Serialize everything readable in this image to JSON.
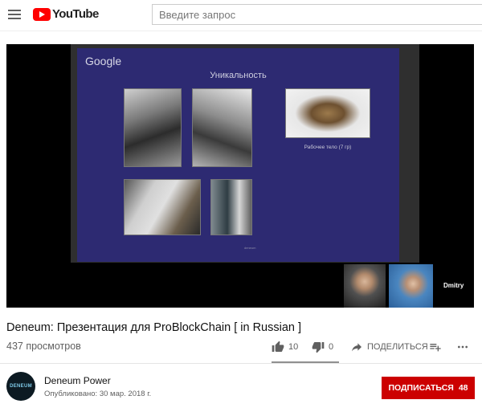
{
  "header": {
    "logo_text": "YouTube",
    "search_placeholder": "Введите запрос"
  },
  "player": {
    "slide": {
      "brand": "Google",
      "title": "Уникальность",
      "caption": "Рабочее тело (7 гр)",
      "footer_mark": "deneum"
    },
    "participant_name": "Dmitry"
  },
  "video": {
    "title": "Deneum: Презентация для ProBlockChain [ in Russian ]",
    "views": "437 просмотров",
    "likes": "10",
    "dislikes": "0",
    "share_label": "ПОДЕЛИТЬСЯ"
  },
  "channel": {
    "name": "Deneum Power",
    "published": "Опубликовано: 30 мар. 2018 г.",
    "avatar_text": "DENEUM",
    "subscribe_label": "ПОДПИСАТЬСЯ",
    "subscriber_count": "48"
  },
  "icons": {
    "menu": "hamburger-icon",
    "like": "thumbs-up-icon",
    "dislike": "thumbs-down-icon",
    "share": "share-arrow-icon",
    "add_to_playlist": "playlist-add-icon",
    "more": "more-horizontal-icon"
  },
  "colors": {
    "brand_red": "#ff0000",
    "subscribe_red": "#cc0000",
    "slide_bg": "#2d2a72"
  }
}
